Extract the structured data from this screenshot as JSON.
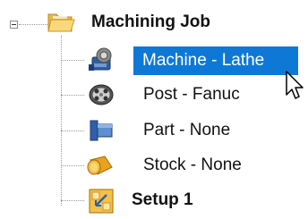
{
  "tree": {
    "root": {
      "label": "Machining Job",
      "icon": "folder-icon",
      "expanded": true
    },
    "children": [
      {
        "label": "Machine - Lathe",
        "icon": "lathe-machine-icon",
        "selected": true
      },
      {
        "label": "Post - Fanuc",
        "icon": "post-processor-icon",
        "selected": false
      },
      {
        "label": "Part - None",
        "icon": "part-icon",
        "selected": false
      },
      {
        "label": "Stock - None",
        "icon": "stock-icon",
        "selected": false
      },
      {
        "label": "Setup 1",
        "icon": "setup-icon",
        "selected": false
      }
    ]
  },
  "colors": {
    "selection": "#0e78d7",
    "connector": "#9a9a9a"
  }
}
